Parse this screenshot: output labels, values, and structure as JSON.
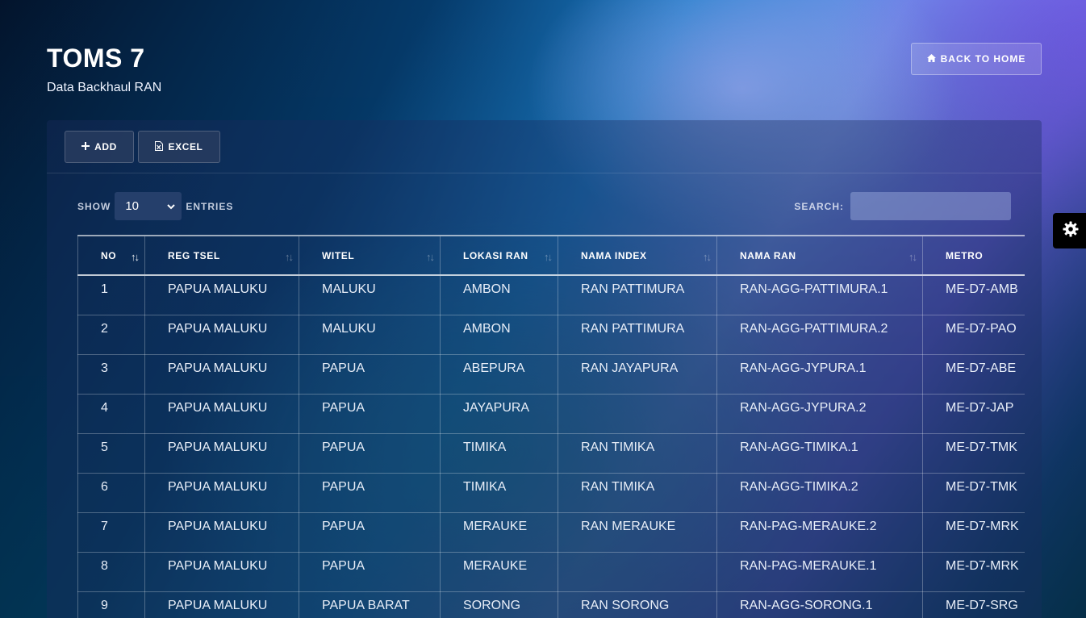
{
  "header": {
    "title": "TOMS 7",
    "subtitle": "Data Backhaul RAN",
    "back_home_label": "BACK TO HOME"
  },
  "toolbar": {
    "add_label": "ADD",
    "excel_label": "EXCEL"
  },
  "controls": {
    "show_label": "SHOW",
    "entries_value": "10",
    "entries_label": "ENTRIES",
    "search_label": "SEARCH:",
    "search_value": ""
  },
  "table": {
    "columns": [
      "NO",
      "REG TSEL",
      "WITEL",
      "LOKASI RAN",
      "NAMA INDEX",
      "NAMA RAN",
      "METRO"
    ],
    "rows": [
      [
        "1",
        "PAPUA MALUKU",
        "MALUKU",
        "AMBON",
        "RAN PATTIMURA",
        "RAN-AGG-PATTIMURA.1",
        "ME-D7-AMB"
      ],
      [
        "2",
        "PAPUA MALUKU",
        "MALUKU",
        "AMBON",
        "RAN PATTIMURA",
        "RAN-AGG-PATTIMURA.2",
        "ME-D7-PAO"
      ],
      [
        "3",
        "PAPUA MALUKU",
        "PAPUA",
        "ABEPURA",
        "RAN JAYAPURA",
        "RAN-AGG-JYPURA.1",
        "ME-D7-ABE"
      ],
      [
        "4",
        "PAPUA MALUKU",
        "PAPUA",
        "JAYAPURA",
        "",
        "RAN-AGG-JYPURA.2",
        "ME-D7-JAP"
      ],
      [
        "5",
        "PAPUA MALUKU",
        "PAPUA",
        "TIMIKA",
        "RAN TIMIKA",
        "RAN-AGG-TIMIKA.1",
        "ME-D7-TMK"
      ],
      [
        "6",
        "PAPUA MALUKU",
        "PAPUA",
        "TIMIKA",
        "RAN TIMIKA",
        "RAN-AGG-TIMIKA.2",
        "ME-D7-TMK"
      ],
      [
        "7",
        "PAPUA MALUKU",
        "PAPUA",
        "MERAUKE",
        "RAN MERAUKE",
        "RAN-PAG-MERAUKE.2",
        "ME-D7-MRK"
      ],
      [
        "8",
        "PAPUA MALUKU",
        "PAPUA",
        "MERAUKE",
        "",
        "RAN-PAG-MERAUKE.1",
        "ME-D7-MRK"
      ],
      [
        "9",
        "PAPUA MALUKU",
        "PAPUA BARAT",
        "SORONG",
        "RAN SORONG",
        "RAN-AGG-SORONG.1",
        "ME-D7-SRG"
      ]
    ]
  },
  "icons": {
    "home": "home-icon",
    "plus": "plus-icon",
    "excel": "file-excel-icon",
    "sort": "sort-icon",
    "settings": "gear-icon"
  }
}
